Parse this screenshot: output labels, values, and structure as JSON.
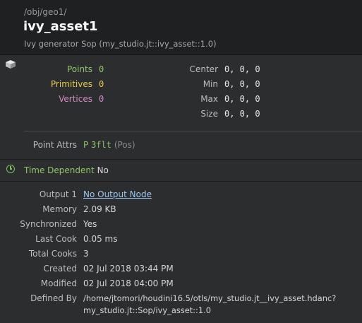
{
  "header": {
    "path": "/obj/geo1/",
    "title": "ivy_asset1",
    "subtitle": "Ivy generator Sop (my_studio.jt::ivy_asset::1.0)"
  },
  "geometry": {
    "points_label": "Points",
    "points_value": "0",
    "primitives_label": "Primitives",
    "primitives_value": "0",
    "vertices_label": "Vertices",
    "vertices_value": "0",
    "center_label": "Center",
    "center_value": "0, 0, 0",
    "min_label": "Min",
    "min_value": "0, 0, 0",
    "max_label": "Max",
    "max_value": "0, 0, 0",
    "size_label": "Size",
    "size_value": "0, 0, 0"
  },
  "attributes": {
    "label": "Point Attrs",
    "class": "P",
    "type": "3flt",
    "name": "(Pos)"
  },
  "time_dependent": {
    "label": "Time Dependent",
    "value": "No"
  },
  "info": {
    "output1_label": "Output 1",
    "output1_value": "No Output Node",
    "memory_label": "Memory",
    "memory_value": "2.09 KB",
    "synchronized_label": "Synchronized",
    "synchronized_value": "Yes",
    "last_cook_label": "Last Cook",
    "last_cook_value": "0.05 ms",
    "total_cooks_label": "Total Cooks",
    "total_cooks_value": "3",
    "created_label": "Created",
    "created_value": "02 Jul 2018 03:44 PM",
    "modified_label": "Modified",
    "modified_value": "02 Jul 2018 04:00 PM",
    "defined_by_label": "Defined By",
    "defined_by_line1": "/home/jtomori/houdini16.5/otls/my_studio.jt__ivy_asset.hdanc?",
    "defined_by_line2": "my_studio.jt::Sop/ivy_asset::1.0"
  }
}
